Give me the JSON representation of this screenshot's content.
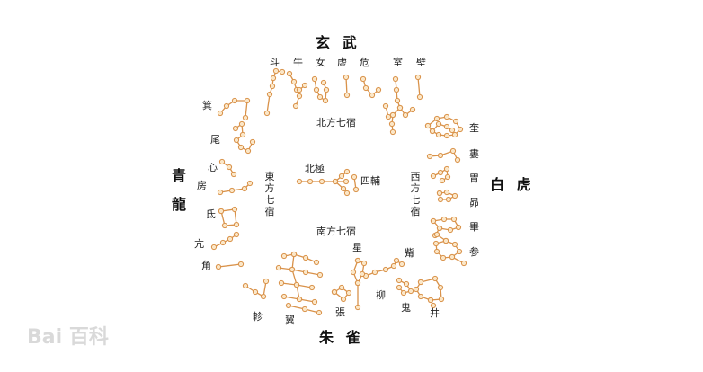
{
  "quadrants": {
    "north": "玄 武",
    "west": "白 虎",
    "south": "朱 雀",
    "east_top": "青",
    "east_bottom": "龍"
  },
  "center": {
    "north_label": "北方七宿",
    "south_label": "南方七宿",
    "east_label": "東方七宿",
    "west_label": "西方七宿",
    "pole": "北極",
    "sifu": "四輔"
  },
  "mansions": {
    "dou": "斗",
    "niu": "牛",
    "nu": "女",
    "xu": "虚",
    "wei_n": "危",
    "shi": "室",
    "bi": "壁",
    "kui": "奎",
    "lou": "婁",
    "wei_w": "胃",
    "mao": "昴",
    "bi_w": "畢",
    "can": "参",
    "zi": "觜",
    "jing": "井",
    "gui": "鬼",
    "liu": "柳",
    "xing": "星",
    "zhang": "張",
    "yi": "翼",
    "zhen": "軫",
    "jiao": "角",
    "kang": "亢",
    "di": "氐",
    "fang": "房",
    "xin": "心",
    "wei_e": "尾",
    "ji": "箕"
  },
  "watermark": "Bai 百科",
  "colors": {
    "star_line": "#d9924a",
    "star_fill": "#fbe7c8"
  }
}
